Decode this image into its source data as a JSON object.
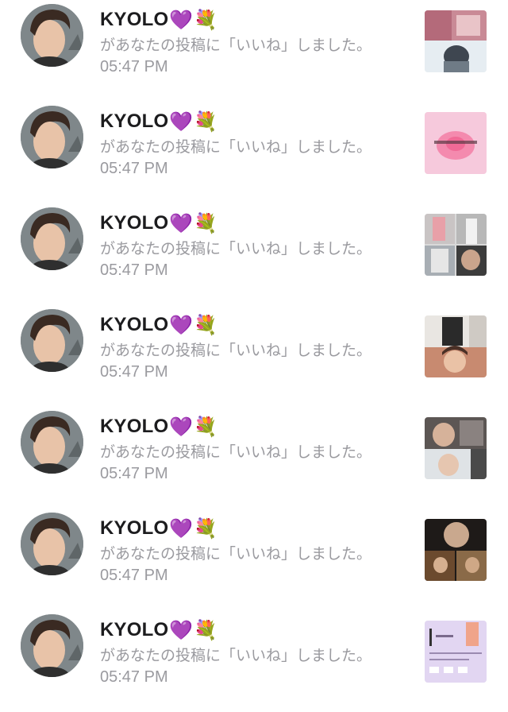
{
  "notifications": [
    {
      "user": "KYOLO",
      "emoji_heart": "💜",
      "emoji_flower": "💐",
      "message": "があなたの投稿に「いいね」しました。",
      "time": "05:47 PM",
      "thumbnail": "photo-collage-pink"
    },
    {
      "user": "KYOLO",
      "emoji_heart": "💜",
      "emoji_flower": "💐",
      "message": "があなたの投稿に「いいね」しました。",
      "time": "05:47 PM",
      "thumbnail": "pink-heart-graphic"
    },
    {
      "user": "KYOLO",
      "emoji_heart": "💜",
      "emoji_flower": "💐",
      "message": "があなたの投稿に「いいね」しました。",
      "time": "05:47 PM",
      "thumbnail": "photo-collage-grid"
    },
    {
      "user": "KYOLO",
      "emoji_heart": "💜",
      "emoji_flower": "💐",
      "message": "があなたの投稿に「いいね」しました。",
      "time": "05:47 PM",
      "thumbnail": "photo-collage-warm"
    },
    {
      "user": "KYOLO",
      "emoji_heart": "💜",
      "emoji_flower": "💐",
      "message": "があなたの投稿に「いいね」しました。",
      "time": "05:47 PM",
      "thumbnail": "photo-collage-gray"
    },
    {
      "user": "KYOLO",
      "emoji_heart": "💜",
      "emoji_flower": "💐",
      "message": "があなたの投稿に「いいね」しました。",
      "time": "05:47 PM",
      "thumbnail": "photo-collage-dark"
    },
    {
      "user": "KYOLO",
      "emoji_heart": "💜",
      "emoji_flower": "💐",
      "message": "があなたの投稿に「いいね」しました。",
      "time": "05:47 PM",
      "thumbnail": "type-chart-lavender"
    }
  ],
  "colors": {
    "username": "#1c1c1e",
    "secondary_text": "#9a9a9f",
    "background": "#ffffff"
  }
}
